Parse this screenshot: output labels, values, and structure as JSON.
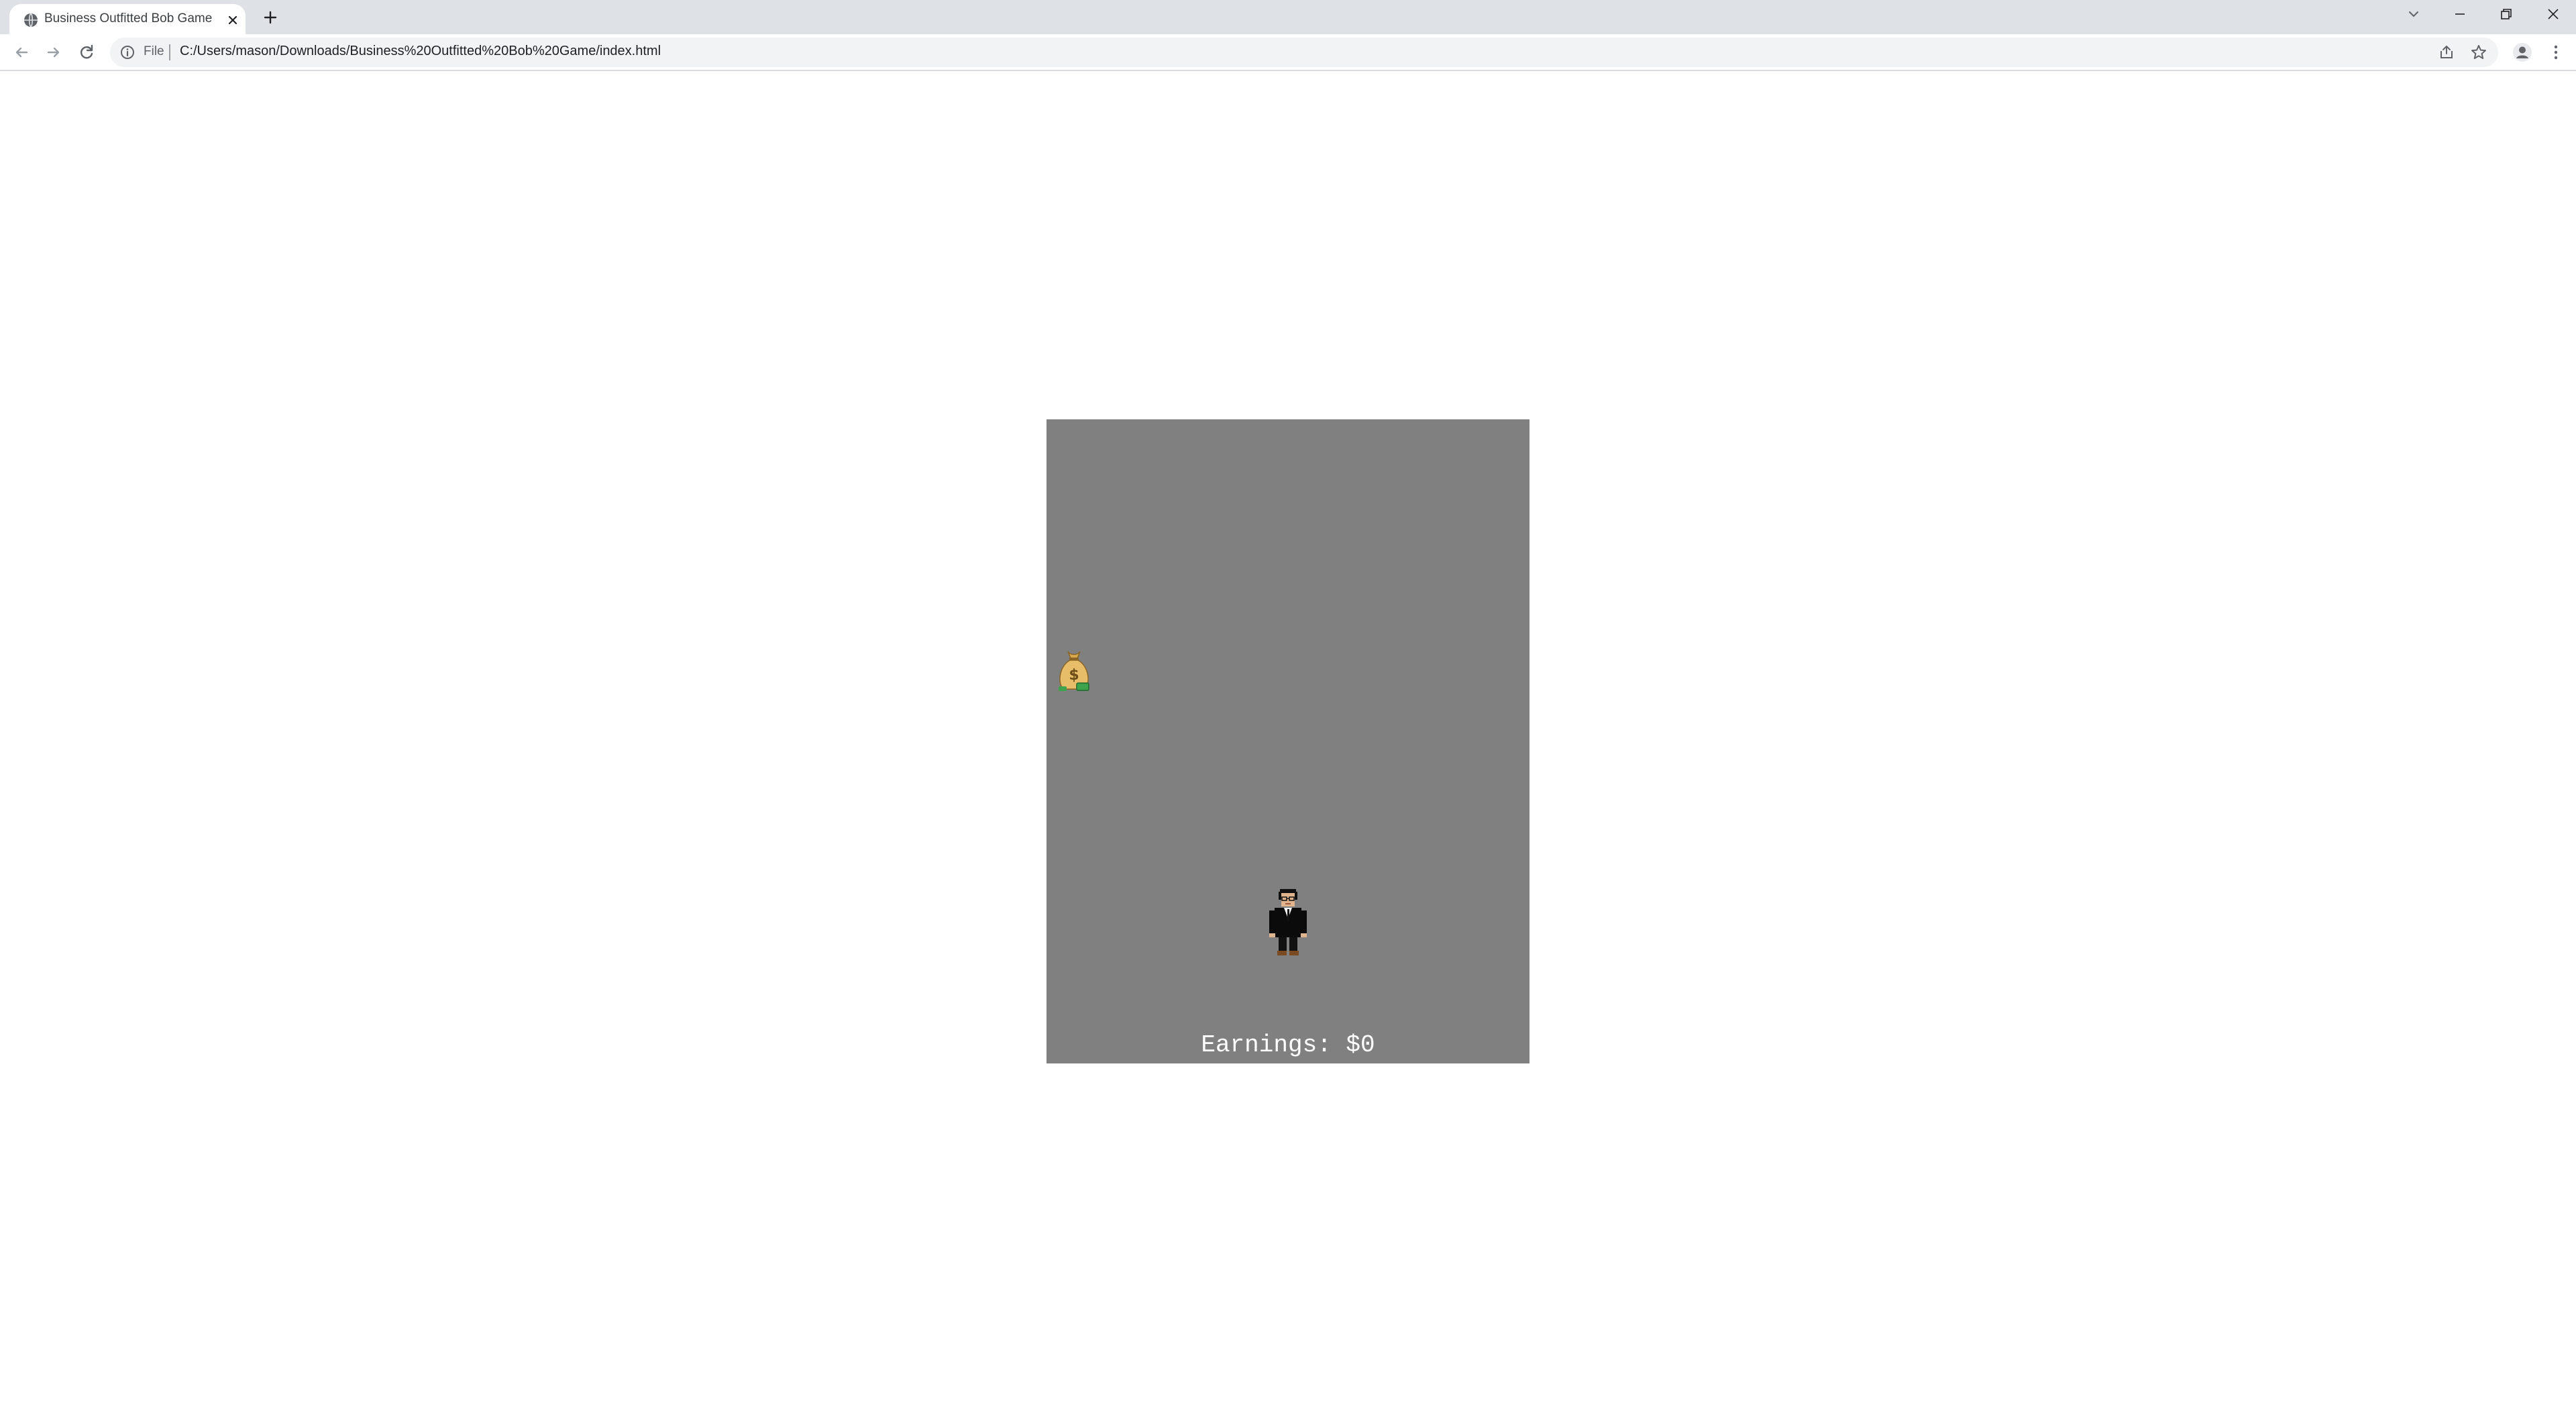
{
  "browser": {
    "tab": {
      "title": "Business Outfitted Bob Game",
      "favicon": "globe-icon",
      "close_icon": "close-icon"
    },
    "new_tab_icon": "plus-icon",
    "window_controls": [
      "chevron-down-icon",
      "minimize-icon",
      "restore-icon",
      "close-icon"
    ],
    "toolbar": {
      "back_icon": "back-arrow-icon",
      "forward_icon": "forward-arrow-icon",
      "reload_icon": "reload-icon",
      "site_info_icon": "info-icon",
      "scheme_label": "File",
      "url": "C:/Users/mason/Downloads/Business%20Outfitted%20Bob%20Game/index.html",
      "share_icon": "share-icon",
      "bookmark_icon": "star-icon",
      "profile_icon": "profile-icon",
      "menu_icon": "kebab-menu-icon"
    }
  },
  "game": {
    "background_color": "#808080",
    "score_label": "Earnings: $0",
    "falling_item_icon": "money-bag-icon",
    "player_sprite": "businessman-sprite"
  }
}
